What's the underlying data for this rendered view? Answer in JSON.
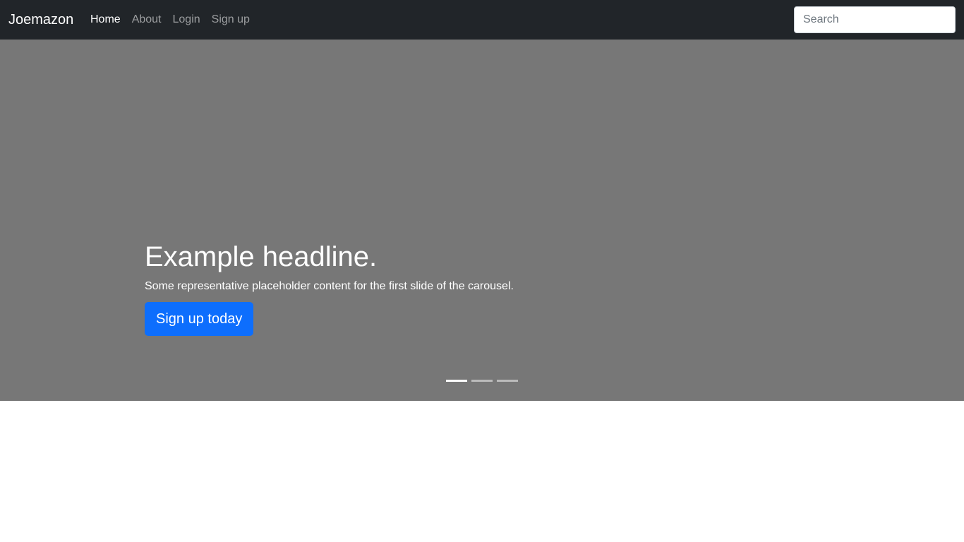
{
  "navbar": {
    "brand": "Joemazon",
    "links": [
      {
        "label": "Home",
        "active": true
      },
      {
        "label": "About",
        "active": false
      },
      {
        "label": "Login",
        "active": false
      },
      {
        "label": "Sign up",
        "active": false
      }
    ],
    "search": {
      "placeholder": "Search",
      "value": ""
    }
  },
  "carousel": {
    "slide": {
      "headline": "Example headline.",
      "text": "Some representative placeholder content for the first slide of the carousel.",
      "button_label": "Sign up today"
    },
    "indicators": {
      "count": 3,
      "active_index": 0
    }
  },
  "colors": {
    "navbar_bg": "#212529",
    "carousel_bg": "#777777",
    "primary": "#0d6efd"
  }
}
